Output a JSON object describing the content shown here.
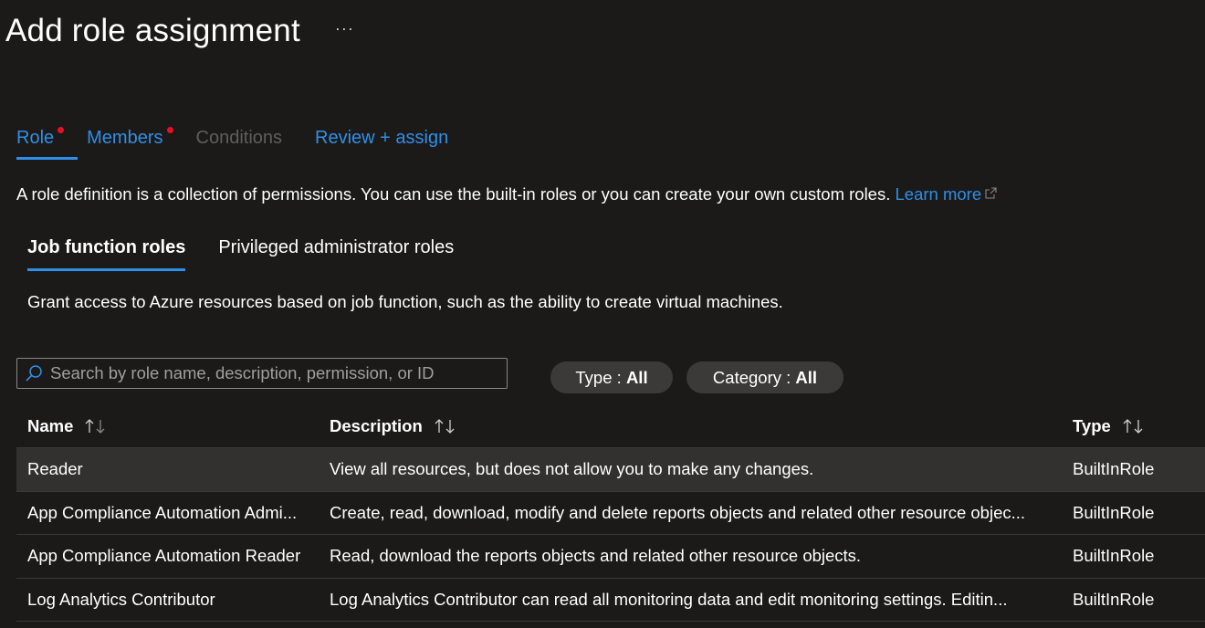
{
  "page": {
    "title": "Add role assignment",
    "more_label": "···"
  },
  "wizard_tabs": [
    {
      "label": "Role",
      "state": "active",
      "required": true
    },
    {
      "label": "Members",
      "state": "enabled",
      "required": true
    },
    {
      "label": "Conditions",
      "state": "disabled",
      "required": false
    },
    {
      "label": "Review + assign",
      "state": "enabled",
      "required": false
    }
  ],
  "intro": {
    "text": "A role definition is a collection of permissions. You can use the built-in roles or you can create your own custom roles. ",
    "link_label": "Learn more"
  },
  "role_tabs": [
    {
      "label": "Job function roles",
      "active": true
    },
    {
      "label": "Privileged administrator roles",
      "active": false
    }
  ],
  "grant_text": "Grant access to Azure resources based on job function, such as the ability to create virtual machines.",
  "search": {
    "placeholder": "Search by role name, description, permission, or ID",
    "value": ""
  },
  "filters": {
    "type": {
      "label": "Type : ",
      "value": "All"
    },
    "category": {
      "label": "Category : ",
      "value": "All"
    }
  },
  "table": {
    "columns": [
      "Name",
      "Description",
      "Type"
    ],
    "rows": [
      {
        "name": "Reader",
        "description": "View all resources, but does not allow you to make any changes.",
        "type": "BuiltInRole",
        "selected": true
      },
      {
        "name": "App Compliance Automation Admi...",
        "description": "Create, read, download, modify and delete reports objects and related other resource objec...",
        "type": "BuiltInRole",
        "selected": false
      },
      {
        "name": "App Compliance Automation Reader",
        "description": "Read, download the reports objects and related other resource objects.",
        "type": "BuiltInRole",
        "selected": false
      },
      {
        "name": "Log Analytics Contributor",
        "description": "Log Analytics Contributor can read all monitoring data and edit monitoring settings. Editin...",
        "type": "BuiltInRole",
        "selected": false
      }
    ]
  },
  "colors": {
    "background": "#1b1a19",
    "accent": "#2f8fe8",
    "required_dot": "#e81123",
    "pill": "#3b3a39",
    "selected_row": "#323130"
  },
  "icons": [
    "ellipsis-icon",
    "external-link-icon",
    "search-icon",
    "sort-icon"
  ]
}
